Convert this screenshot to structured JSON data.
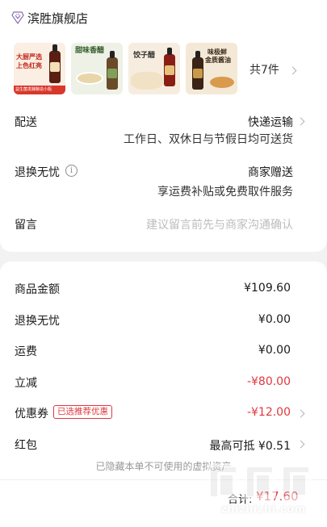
{
  "store": {
    "name": "滨胜旗舰店"
  },
  "products": {
    "thumbnails": [
      {
        "title1": "大厨严选",
        "title2": "上色红亮",
        "caption": "益生菌发酵酿造小瓶"
      },
      {
        "title1": "甜味香醋",
        "title2": "",
        "caption": ""
      },
      {
        "title1": "饺子醋",
        "title2": "",
        "caption": ""
      },
      {
        "title1": "味极鲜",
        "title2": "金质酱油",
        "caption": ""
      }
    ],
    "count_label": "共7件"
  },
  "delivery": {
    "label": "配送",
    "method": "快递运输",
    "schedule": "工作日、双休日与节假日均可送货"
  },
  "return_policy": {
    "label": "退换无忧",
    "info_icon": "i",
    "value": "商家赠送",
    "detail": "享运费补贴或免费取件服务"
  },
  "message": {
    "label": "留言",
    "placeholder": "建议留言前先与商家沟通确认"
  },
  "summary": {
    "rows": [
      {
        "label": "商品金额",
        "amount": "¥109.60"
      },
      {
        "label": "退换无忧",
        "amount": "¥0.00"
      },
      {
        "label": "运费",
        "amount": "¥0.00"
      },
      {
        "label": "立减",
        "amount": "-¥80.00"
      },
      {
        "label": "优惠券",
        "amount": "-¥12.00",
        "badge": "已选推荐优惠"
      },
      {
        "label": "红包",
        "amount": "最高可抵 ¥0.51"
      }
    ],
    "hidden_note": "已隐藏本单不可使用的虚拟资产"
  },
  "footer": {
    "total_label": "合计:",
    "total_value": "¥17.60"
  },
  "watermark": {
    "text": "zhizhizhi.com"
  },
  "colors": {
    "accent_red": "#e0383e",
    "background": "#f2f2f2"
  }
}
